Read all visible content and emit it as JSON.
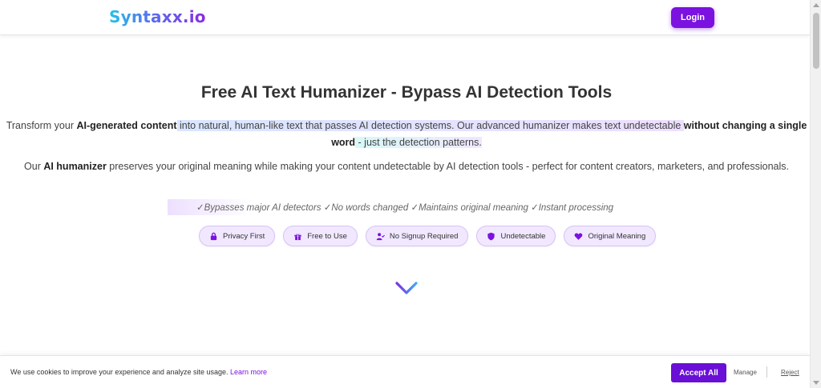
{
  "header": {
    "logo": "Syntaxx.io",
    "login_label": "Login"
  },
  "hero": {
    "title": "Free AI Text Humanizer - Bypass AI Detection Tools",
    "para1": {
      "t1": "Transform your ",
      "b1": "AI-generated content",
      "t2": " into natural, human-like text that passes AI detection systems. Our advanced humanizer makes text undetectable ",
      "b2": "without changing a single word",
      "t3": " - just the detection patterns."
    },
    "para2": {
      "t1": "Our ",
      "b1": "AI humanizer",
      "t2": " preserves your original meaning while making your content undetectable by AI detection tools - perfect for content creators, marketers, and professionals."
    },
    "features": "✓Bypasses major AI detectors ✓No words changed ✓Maintains original meaning ✓Instant processing"
  },
  "badges": [
    {
      "label": "Privacy First",
      "icon": "lock-icon"
    },
    {
      "label": "Free to Use",
      "icon": "gift-icon"
    },
    {
      "label": "No Signup Required",
      "icon": "user-check-icon"
    },
    {
      "label": "Undetectable",
      "icon": "shield-icon"
    },
    {
      "label": "Original Meaning",
      "icon": "heart-icon"
    }
  ],
  "cookie": {
    "text": "We use cookies to improve your experience and analyze site usage.",
    "link": "Learn more",
    "accept_label": "Accept All",
    "manage_label": "Manage",
    "reject_label": "Reject"
  },
  "colors": {
    "accent": "#7b12e0",
    "badge_bg": "#f1e8ff"
  }
}
